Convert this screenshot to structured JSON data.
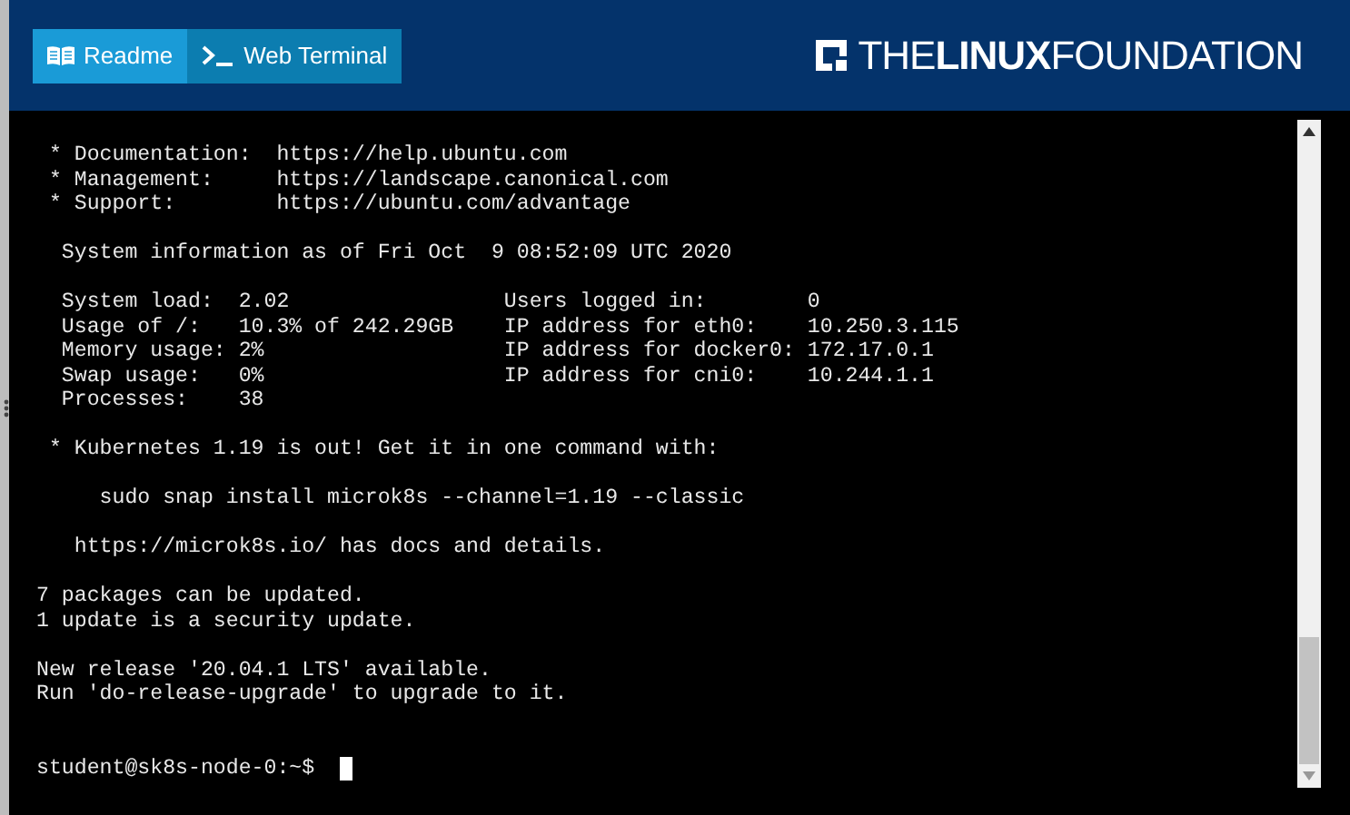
{
  "tabs": [
    {
      "label": "Readme",
      "selected": true
    },
    {
      "label": "Web Terminal",
      "selected": false
    }
  ],
  "logo": {
    "text": "THE**LINUX**FOUNDATION"
  },
  "terminal": {
    "blocks": [
      [
        " * Documentation:  https://help.ubuntu.com",
        " * Management:     https://landscape.canonical.com",
        " * Support:        https://ubuntu.com/advantage"
      ],
      [
        "  System information as of Fri Oct  9 08:52:09 UTC 2020"
      ],
      [
        "  System load:  2.02                 Users logged in:        0",
        "  Usage of /:   10.3% of 242.29GB    IP address for eth0:    10.250.3.115",
        "  Memory usage: 2%                   IP address for docker0: 172.17.0.1",
        "  Swap usage:   0%                   IP address for cni0:    10.244.1.1",
        "  Processes:    38"
      ],
      [
        " * Kubernetes 1.19 is out! Get it in one command with:"
      ],
      [
        "     sudo snap install microk8s --channel=1.19 --classic"
      ],
      [
        "   https://microk8s.io/ has docs and details."
      ],
      [
        "7 packages can be updated.",
        "1 update is a security update."
      ],
      [
        "New release '20.04.1 LTS' available.",
        "Run 'do-release-upgrade' to upgrade to it."
      ]
    ],
    "prompt": "student@sk8s-node-0:~$ "
  }
}
